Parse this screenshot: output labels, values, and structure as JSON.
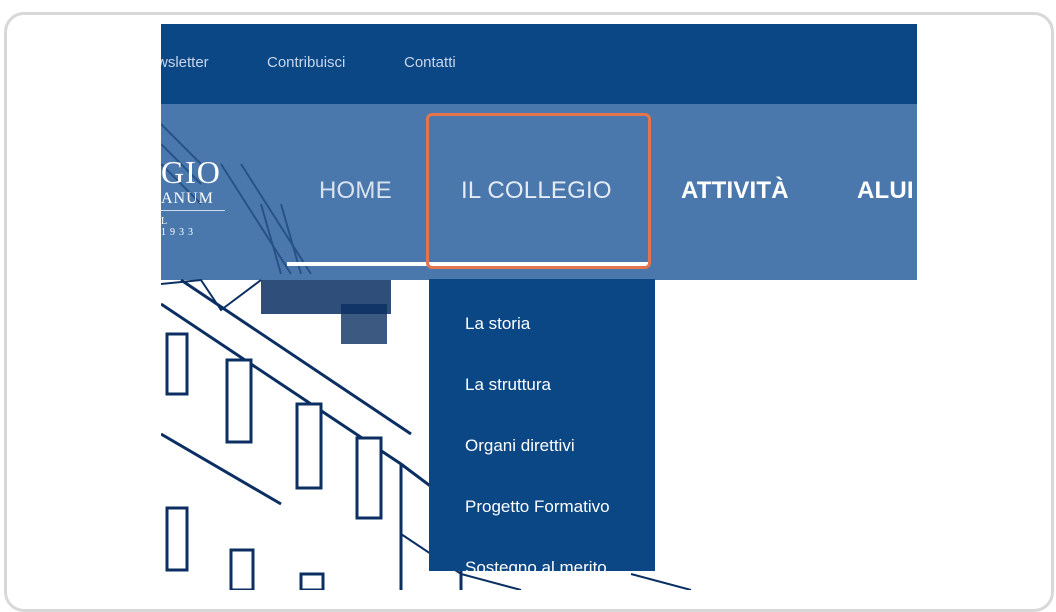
{
  "topbar": {
    "links": [
      "wsletter",
      "Contribuisci",
      "Contatti"
    ]
  },
  "logo": {
    "line1": "GIO",
    "line2": "ANUM",
    "line3": "L 1933"
  },
  "nav": {
    "items": [
      "HOME",
      "IL COLLEGIO",
      "ATTIVITÀ",
      "ALUI"
    ],
    "active": "IL COLLEGIO"
  },
  "dropdown": {
    "items": [
      "La storia",
      "La struttura",
      "Organi direttivi",
      "Progetto Formativo",
      "Sostegno al merito"
    ]
  },
  "colors": {
    "topbar": "#0b4685",
    "navbar": "#4a78ad",
    "dropdown": "#0b4685",
    "highlight_border": "#e2744e"
  }
}
